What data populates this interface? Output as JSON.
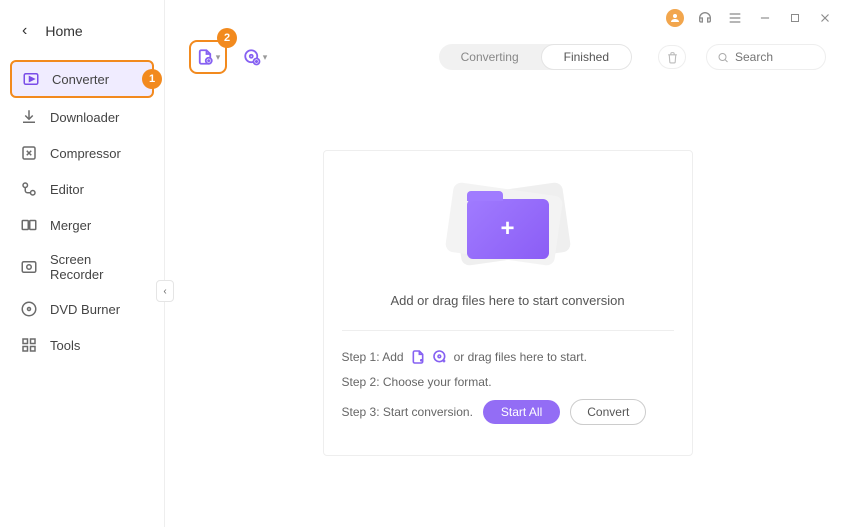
{
  "home_label": "Home",
  "sidebar": {
    "items": [
      {
        "label": "Converter"
      },
      {
        "label": "Downloader"
      },
      {
        "label": "Compressor"
      },
      {
        "label": "Editor"
      },
      {
        "label": "Merger"
      },
      {
        "label": "Screen Recorder"
      },
      {
        "label": "DVD Burner"
      },
      {
        "label": "Tools"
      }
    ]
  },
  "badges": {
    "one": "1",
    "two": "2"
  },
  "tabs": {
    "converting": "Converting",
    "finished": "Finished"
  },
  "search": {
    "placeholder": "Search"
  },
  "dropzone": {
    "text": "Add or drag files here to start conversion"
  },
  "steps": {
    "s1_prefix": "Step 1: Add",
    "s1_suffix": "or drag files here to start.",
    "s2": "Step 2: Choose your format.",
    "s3": "Step 3: Start conversion."
  },
  "buttons": {
    "start_all": "Start All",
    "convert": "Convert"
  }
}
